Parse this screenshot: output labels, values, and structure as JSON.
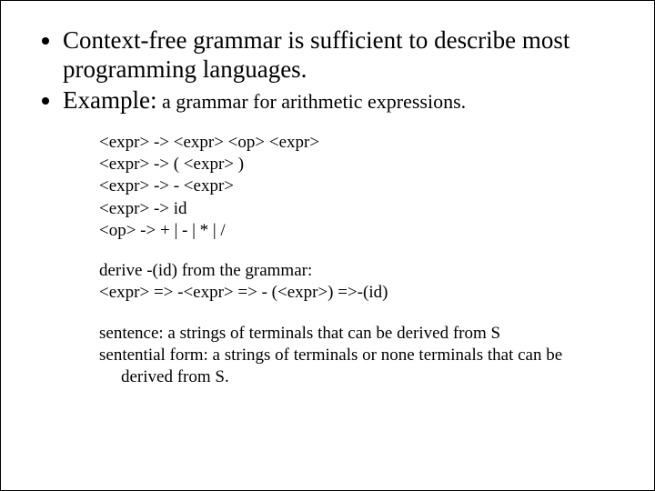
{
  "bullets": {
    "b1": "Context-free grammar is sufficient to describe most programming languages.",
    "b2_prefix": "Example:",
    "b2_rest": " a grammar for arithmetic expressions."
  },
  "grammar": {
    "r1": "<expr> -> <expr> <op> <expr>",
    "r2": "<expr> -> ( <expr> )",
    "r3": "<expr> -> - <expr>",
    "r4": "<expr> -> id",
    "r5": "<op> -> + | - | * | /"
  },
  "derive": {
    "line1": "derive -(id) from the grammar:",
    "line2": "<expr> => -<expr> => - (<expr>) =>-(id)"
  },
  "defs": {
    "sentence": "sentence: a strings of terminals that can be derived from S",
    "sentential": "sentential form: a strings of terminals or none terminals that can be derived from S."
  }
}
